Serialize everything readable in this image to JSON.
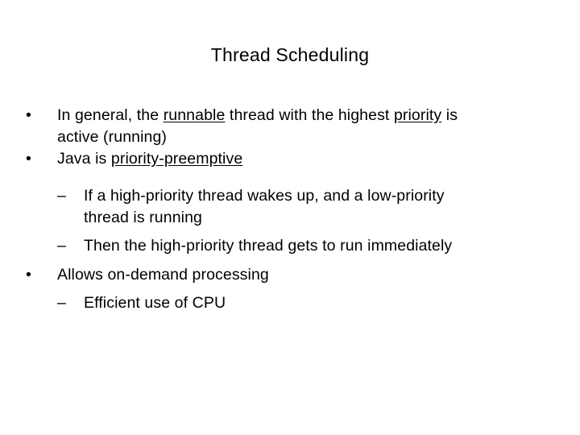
{
  "slide": {
    "title": "Thread Scheduling",
    "bullets": [
      {
        "marker": "•",
        "lines": [
          {
            "segments": [
              {
                "text": "In general, the ",
                "underline": false
              },
              {
                "text": "runnable",
                "underline": true
              },
              {
                "text": " thread with the highest ",
                "underline": false
              },
              {
                "text": "priority",
                "underline": true
              },
              {
                "text": " is",
                "underline": false
              }
            ]
          },
          {
            "segments": [
              {
                "text": "active (running)",
                "underline": false
              }
            ]
          }
        ]
      },
      {
        "marker": "•",
        "lines": [
          {
            "segments": [
              {
                "text": "Java is ",
                "underline": false
              },
              {
                "text": "priority-preemptive",
                "underline": true
              }
            ]
          }
        ]
      },
      {
        "marker": "–",
        "level": 2,
        "lines": [
          {
            "segments": [
              {
                "text": "If a high-priority thread wakes up, and a low-priority",
                "underline": false
              }
            ]
          },
          {
            "segments": [
              {
                "text": "thread is running",
                "underline": false
              }
            ]
          }
        ]
      },
      {
        "marker": "–",
        "level": 2,
        "lines": [
          {
            "segments": [
              {
                "text": "Then the high-priority thread gets to run immediately",
                "underline": false
              }
            ]
          }
        ]
      },
      {
        "marker": "•",
        "lines": [
          {
            "segments": [
              {
                "text": "Allows on-demand processing",
                "underline": false
              }
            ]
          }
        ]
      },
      {
        "marker": "–",
        "level": 2,
        "lines": [
          {
            "segments": [
              {
                "text": "Efficient use of CPU",
                "underline": false
              }
            ]
          }
        ]
      }
    ]
  }
}
